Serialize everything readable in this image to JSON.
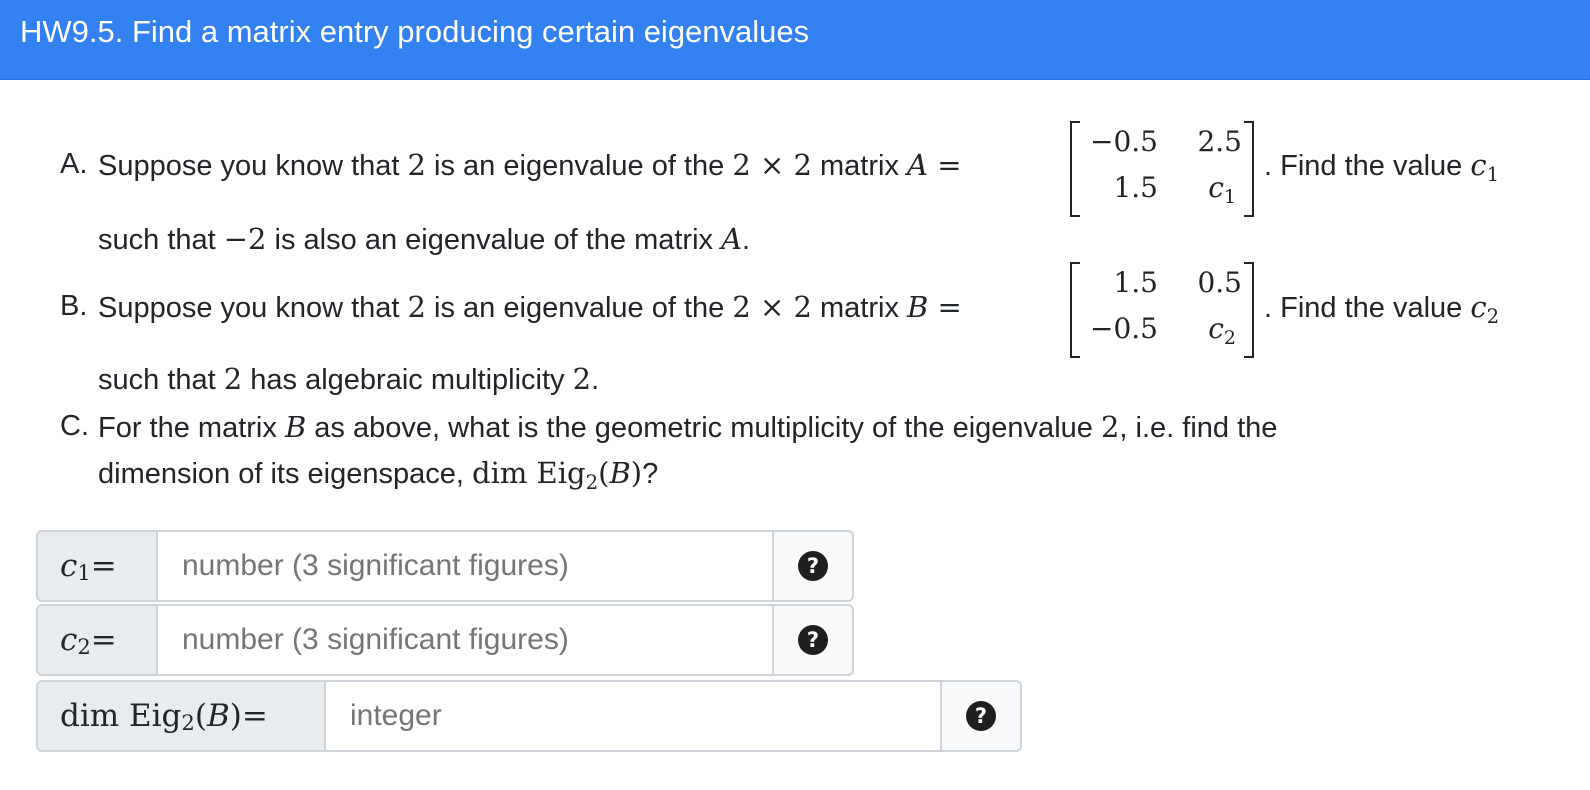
{
  "header": {
    "title": "HW9.5. Find a matrix entry producing certain eigenvalues"
  },
  "parts": [
    {
      "letter": "A.",
      "line1_pre": "Suppose you know that ",
      "eig": "2",
      "mid1": " is an eigenvalue of the ",
      "size": "2 × 2",
      "mid2": " matrix ",
      "var": "A",
      "eq": " =",
      "after": ". Find the value ",
      "c": "c",
      "c_sub": "1",
      "line2_pre": "such that ",
      "line2_eig": "−2",
      "line2_post": " is also an eigenvalue of the matrix ",
      "line2_var": "A",
      "line2_end": ".",
      "matrix": [
        "−0.5",
        "2.5",
        "1.5",
        "c",
        "1"
      ]
    },
    {
      "letter": "B.",
      "line1_pre": "Suppose you know that ",
      "eig": "2",
      "mid1": " is an eigenvalue of the ",
      "size": "2 × 2",
      "mid2": " matrix ",
      "var": "B",
      "eq": " =",
      "after": ". Find the value ",
      "c": "c",
      "c_sub": "2",
      "line2_pre": "such that ",
      "line2_eig": "2",
      "line2_post": " has algebraic multiplicity ",
      "line2_var": "2",
      "line2_end": ".",
      "matrix": [
        "1.5",
        "0.5",
        "−0.5",
        "c",
        "2"
      ]
    },
    {
      "letter": "C.",
      "line1_pre": "For the matrix ",
      "var": "B",
      "line1_mid": " as above, what is the geometric multiplicity of the eigenvalue ",
      "eig": "2",
      "line1_end": ", i.e. find the",
      "line2_pre": "dimension of its eigenspace, ",
      "dim": "dim Eig",
      "dim_sub": "2",
      "dim_arg_open": "(",
      "dim_arg": "B",
      "dim_arg_close": ")",
      "line2_end": "?"
    }
  ],
  "answers": [
    {
      "label_var": "c",
      "label_sub": "1",
      "label_eq": " =",
      "placeholder": "number (3 significant figures)",
      "help": "?"
    },
    {
      "label_var": "c",
      "label_sub": "2",
      "label_eq": " =",
      "placeholder": "number (3 significant figures)",
      "help": "?"
    },
    {
      "label_pre": "dim Eig",
      "label_sub": "2",
      "label_open": "(",
      "label_var": "B",
      "label_close": ")",
      "label_eq": " =",
      "placeholder": "integer",
      "help": "?"
    }
  ]
}
